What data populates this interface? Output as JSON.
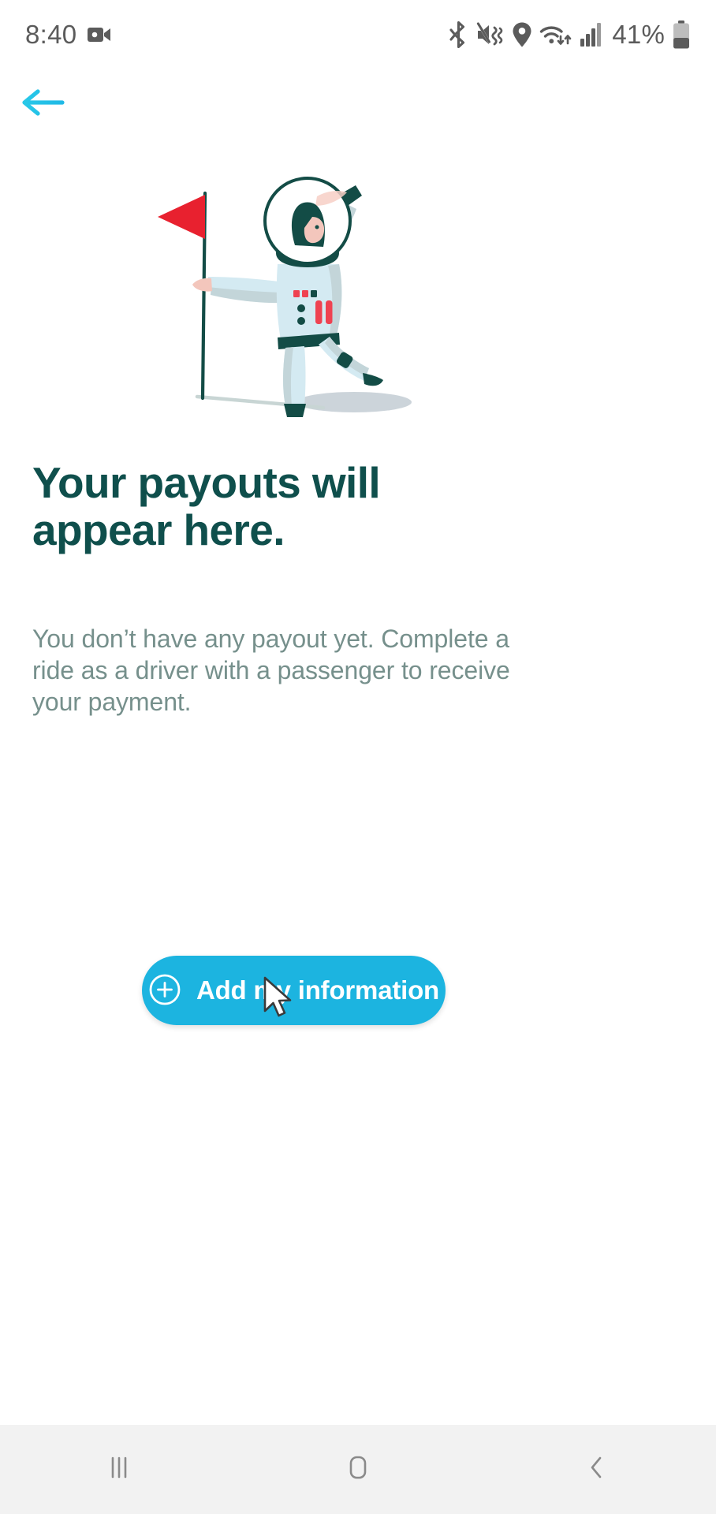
{
  "status_bar": {
    "time": "8:40",
    "battery_percent": "41%",
    "icons": [
      "video-recording-icon",
      "bluetooth-icon",
      "sound-mute-vibrate-icon",
      "location-pin-icon",
      "wifi-icon",
      "cellular-signal-icon",
      "battery-icon"
    ]
  },
  "nav": {
    "back_label": "Back",
    "back_icon": "arrow-left-icon"
  },
  "illustration": {
    "name": "astronaut-planting-flag-illustration",
    "alt": "Astronaut in light blue suit standing next to a red flag",
    "colors": {
      "suit": "#d4eaf2",
      "suit_shade": "#c3d5d9",
      "accent_dark": "#134c46",
      "flag_red": "#e8212f",
      "stripe_red": "#ef4251",
      "shadow": "#c3cdd4",
      "skin": "#f2c0b4"
    }
  },
  "content": {
    "headline": "Your payouts will appear here.",
    "body": "You don’t have any payout yet. Complete a ride as a driver with a passenger to receive your payment."
  },
  "cta": {
    "label": "Add my information",
    "icon": "plus-circle-icon",
    "background_color": "#1cb4e0",
    "text_color": "#ffffff"
  },
  "cursor": {
    "name": "mouse-pointer"
  },
  "system_nav": {
    "recents_label": "Recent apps",
    "home_label": "Home",
    "back_label": "Back",
    "recents_icon": "recents-icon",
    "home_icon": "home-icon",
    "back_icon": "chevron-left-icon"
  },
  "theme": {
    "page_background": "#ffffff",
    "heading_color": "#0f4f4c",
    "body_color": "#76908c",
    "accent": "#1cb4e0",
    "nav_bar_background": "#f2f2f2",
    "status_icon_color": "#5b5b5b"
  }
}
